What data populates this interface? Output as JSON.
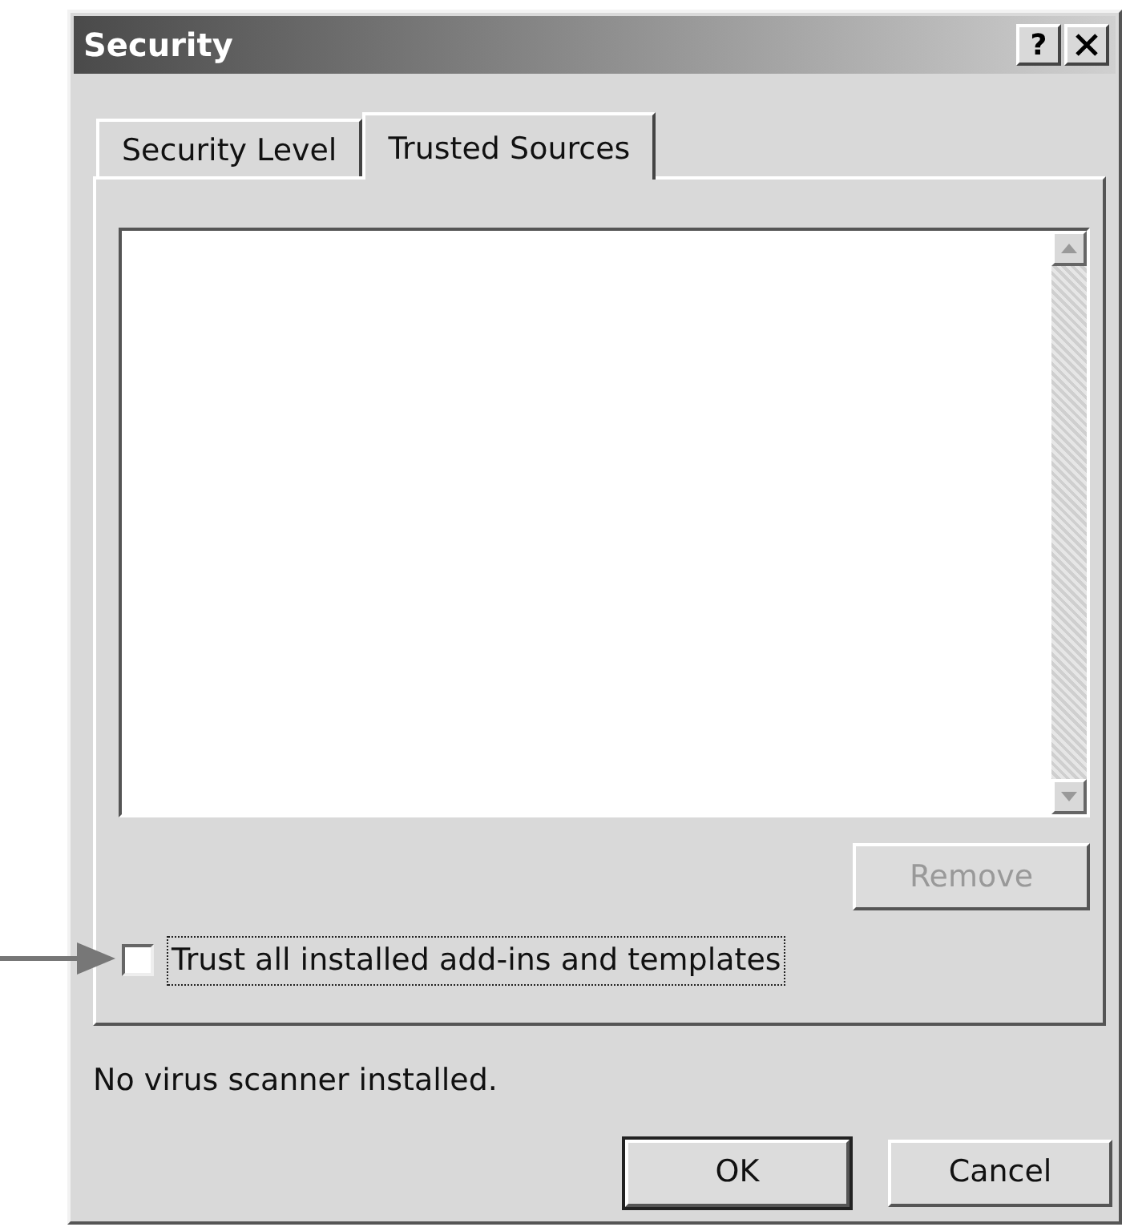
{
  "window": {
    "title": "Security",
    "help_button": "?"
  },
  "tabs": [
    {
      "label": "Security Level",
      "selected": false
    },
    {
      "label": "Trusted Sources",
      "selected": true
    }
  ],
  "remove_button": {
    "label": "Remove",
    "disabled": true
  },
  "trust_checkbox": {
    "label": "Trust all installed add-ins and templates",
    "checked": false,
    "focused": true
  },
  "status_text": "No virus scanner installed.",
  "buttons": [
    {
      "label": "OK",
      "default": true
    },
    {
      "label": "Cancel",
      "default": false
    }
  ]
}
